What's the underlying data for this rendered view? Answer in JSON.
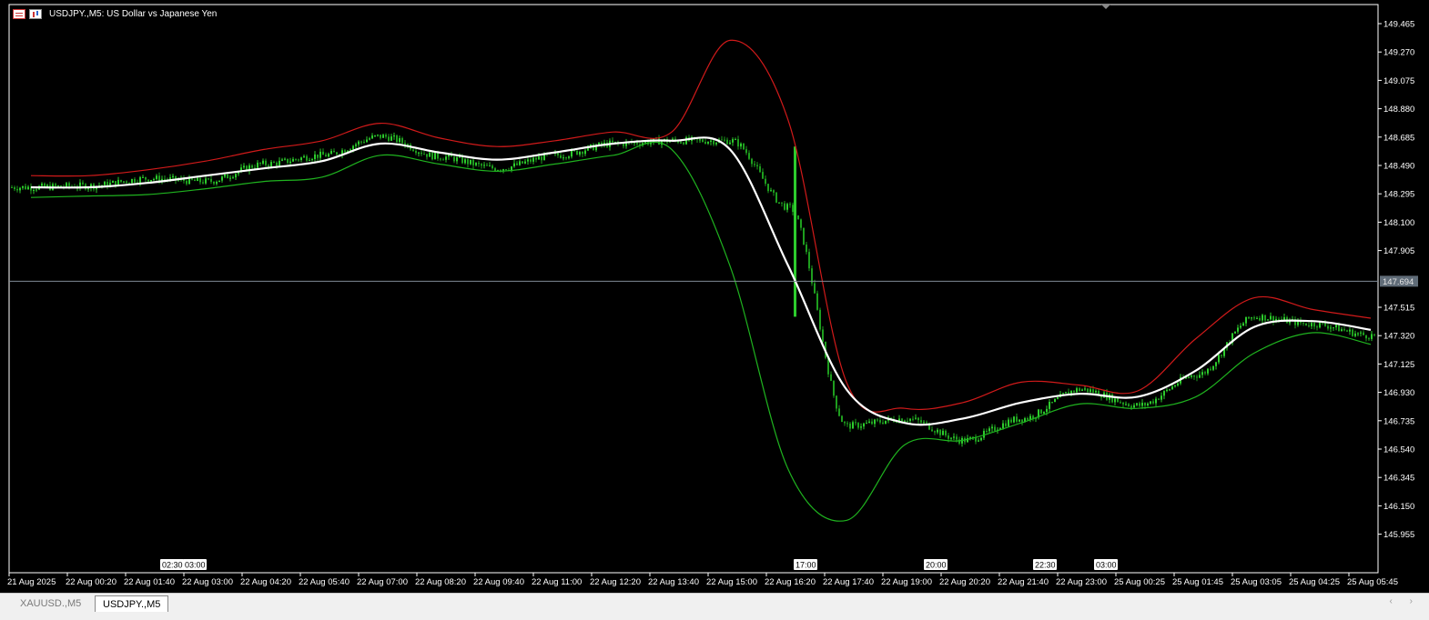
{
  "window": {
    "symbol_title": "USDJPY.,M5:  US Dollar vs Japanese Yen",
    "icons": [
      "chart-table-icon",
      "candlestick-chart-icon"
    ]
  },
  "colors": {
    "background": "#000000",
    "candle_up": "#2dcc2d",
    "candle_down": "#1e9e1e",
    "upper_band": "#d11a1a",
    "lower_band": "#1fb31f",
    "middle_band": "#ffffff",
    "crosshair": "#7f8a95",
    "axis_text": "#ffffff"
  },
  "price_axis": {
    "labels": [
      "149.465",
      "149.270",
      "149.075",
      "148.880",
      "148.685",
      "148.490",
      "148.295",
      "148.100",
      "147.905",
      "147.515",
      "147.320",
      "147.125",
      "146.930",
      "146.735",
      "146.540",
      "146.345",
      "146.150",
      "145.955"
    ],
    "current_price": "147.694"
  },
  "time_axis": {
    "labels": [
      "21 Aug 2025",
      "22 Aug 00:20",
      "22 Aug 01:40",
      "22 Aug 03:00",
      "22 Aug 04:20",
      "22 Aug 05:40",
      "22 Aug 07:00",
      "22 Aug 08:20",
      "22 Aug 09:40",
      "22 Aug 11:00",
      "22 Aug 12:20",
      "22 Aug 13:40",
      "22 Aug 15:00",
      "22 Aug 16:20",
      "22 Aug 17:40",
      "22 Aug 19:00",
      "22 Aug 20:20",
      "22 Aug 21:40",
      "22 Aug 23:00",
      "25 Aug 00:25",
      "25 Aug 01:45",
      "25 Aug 03:05",
      "25 Aug 04:25",
      "25 Aug 05:45"
    ]
  },
  "session_markers": [
    "02:30",
    "03:00",
    "17:00",
    "20:00",
    "22:30",
    "03:00"
  ],
  "tabs": [
    {
      "label": "XAUUSD.,M5",
      "active": false
    },
    {
      "label": "USDJPY.,M5",
      "active": true
    }
  ],
  "chart_data": {
    "type": "line",
    "ylim": [
      145.85,
      149.55
    ],
    "x": [
      "21 Aug 2025",
      "22 Aug 00:20",
      "22 Aug 01:40",
      "22 Aug 03:00",
      "22 Aug 04:20",
      "22 Aug 05:40",
      "22 Aug 07:00",
      "22 Aug 08:20",
      "22 Aug 09:40",
      "22 Aug 11:00",
      "22 Aug 12:20",
      "22 Aug 13:40",
      "22 Aug 15:00",
      "22 Aug 16:20",
      "22 Aug 17:40",
      "22 Aug 19:00",
      "22 Aug 20:20",
      "22 Aug 21:40",
      "22 Aug 23:00",
      "25 Aug 00:25",
      "25 Aug 01:45",
      "25 Aug 03:05",
      "25 Aug 04:25",
      "25 Aug 05:45"
    ],
    "series": [
      {
        "values": [
          148.34,
          148.35,
          148.4,
          148.38,
          148.5,
          148.56,
          148.69,
          148.55,
          148.47,
          148.56,
          148.64,
          148.66,
          148.66,
          148.2,
          146.7,
          146.75,
          146.6,
          146.75,
          146.95,
          146.84,
          147.05,
          147.45,
          147.4,
          147.32
        ]
      },
      {
        "values": [
          148.42,
          148.42,
          148.46,
          148.52,
          148.6,
          148.66,
          148.78,
          148.68,
          148.62,
          148.66,
          148.72,
          148.72,
          149.35,
          148.8,
          147.0,
          146.82,
          146.86,
          147.0,
          146.98,
          146.94,
          147.3,
          147.58,
          147.5,
          147.44
        ]
      },
      {
        "values": [
          148.34,
          148.34,
          148.37,
          148.42,
          148.47,
          148.52,
          148.64,
          148.58,
          148.53,
          148.58,
          148.64,
          148.66,
          148.6,
          147.8,
          146.95,
          146.72,
          146.75,
          146.86,
          146.92,
          146.9,
          147.08,
          147.38,
          147.42,
          147.36
        ]
      },
      {
        "values": [
          148.27,
          148.28,
          148.29,
          148.33,
          148.38,
          148.41,
          148.56,
          148.5,
          148.45,
          148.5,
          148.56,
          148.6,
          147.8,
          146.4,
          146.05,
          146.57,
          146.6,
          146.72,
          146.85,
          146.82,
          146.9,
          147.2,
          147.34,
          147.26
        ]
      }
    ]
  }
}
